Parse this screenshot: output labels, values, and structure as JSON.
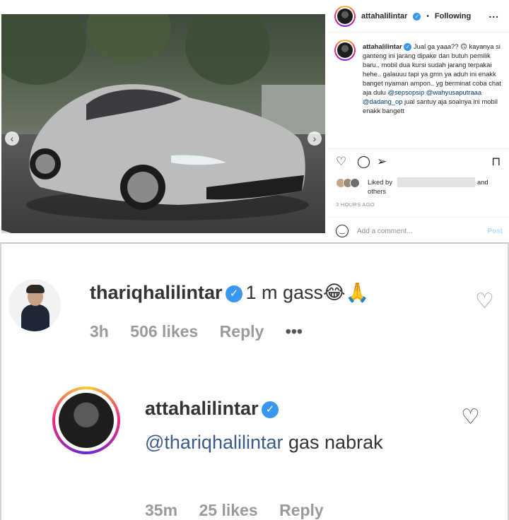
{
  "post": {
    "author": "attahalilintar",
    "separator": "•",
    "follow_status": "Following",
    "more_label": "...",
    "prev_arrow": "‹",
    "next_arrow": "›",
    "carousel": {
      "count": 5,
      "active": 1
    },
    "caption": {
      "author": "attahalilintar",
      "segments": [
        {
          "type": "text",
          "value": "Jual ga yaaa?? 🙃 kayanya si ganteng ini jarang dipake dan butuh pemilik baru.. mobil dua kursi sudah jarang terpakai hehe.. galauuu tapi ya gmn ya aduh ini enakk banget nyaman ampon.. yg berminat coba chat aja dulu "
        },
        {
          "type": "mention",
          "value": "@sepsopsip"
        },
        {
          "type": "text",
          "value": " "
        },
        {
          "type": "mention",
          "value": "@wahyusaputraaa"
        },
        {
          "type": "text",
          "value": " "
        },
        {
          "type": "mention",
          "value": "@dadang_op"
        },
        {
          "type": "text",
          "value": " jual santuy aja soalnya ini mobil enakk bangett"
        }
      ]
    },
    "actions": {
      "like_icon": "heart-icon",
      "comment_icon": "comment-icon",
      "share_icon": "send-icon",
      "save_icon": "bookmark-icon"
    },
    "likes": {
      "prefix": "Liked by",
      "and": "and",
      "others": "others"
    },
    "time": "3 HOURS AGO",
    "add_comment": {
      "placeholder": "Add a comment...",
      "post_label": "Post",
      "emoji_icon": "smile-icon"
    }
  },
  "comments": [
    {
      "user": "thariqhalilintar",
      "text": "1 m gass😂🙏",
      "time": "3h",
      "likes": "506 likes",
      "reply": "Reply",
      "more": "•••"
    },
    {
      "user": "attahalilintar",
      "mention": "@thariqhalilintar",
      "text": " gas nabrak",
      "time": "35m",
      "likes": "25 likes",
      "reply": "Reply"
    }
  ],
  "colors": {
    "verified": "#3897f0",
    "mention": "#00376b",
    "muted": "#8e8e8e",
    "post_button": "#b2dffc"
  }
}
